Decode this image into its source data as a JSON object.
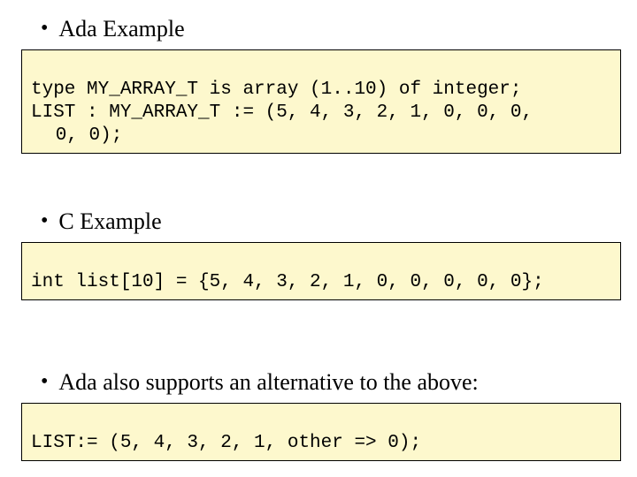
{
  "sections": [
    {
      "bullet_label": "Ada Example",
      "code_lines": [
        "type MY_ARRAY_T is array (1..10) of integer;",
        "LIST : MY_ARRAY_T := (5, 4, 3, 2, 1, 0, 0, 0,",
        " 0, 0);"
      ]
    },
    {
      "bullet_label": "C Example",
      "code_lines": [
        "int list[10] = {5, 4, 3, 2, 1, 0, 0, 0, 0, 0};"
      ]
    },
    {
      "bullet_label": "Ada also supports an alternative to the above:",
      "code_lines": [
        "LIST:= (5, 4, 3, 2, 1, other => 0);"
      ]
    }
  ]
}
